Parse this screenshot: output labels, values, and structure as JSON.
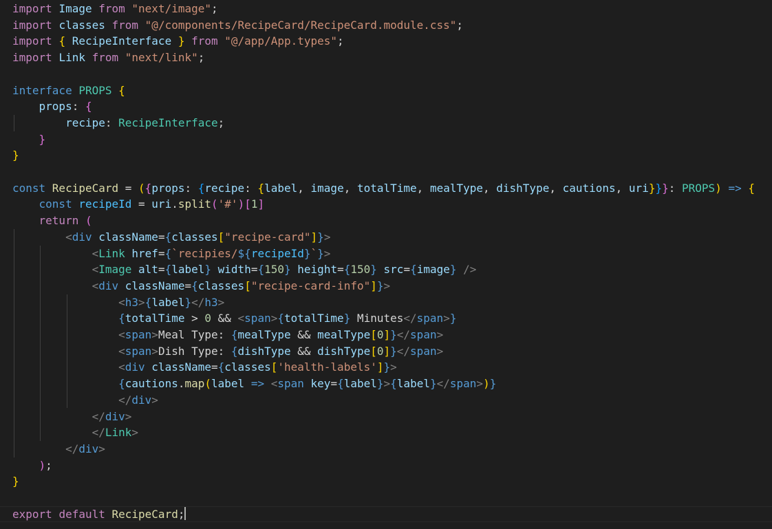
{
  "editor": {
    "colors": {
      "background": "#1e1e1e",
      "keyword": "#569cd6",
      "control": "#c586c0",
      "variable": "#9cdcfe",
      "function": "#dcdcaa",
      "type": "#4ec9b0",
      "string": "#ce9178",
      "number": "#b5cea8",
      "bracket_gold": "#ffd700",
      "bracket_orchid": "#da70d6",
      "bracket_blue": "#179fff"
    },
    "cursor_line": 31,
    "lines": [
      [
        [
          "import ",
          "ctl"
        ],
        [
          "Image ",
          "var"
        ],
        [
          "from ",
          "ctl"
        ],
        [
          "\"next/image\"",
          "str"
        ],
        [
          ";",
          "plain"
        ]
      ],
      [
        [
          "import ",
          "ctl"
        ],
        [
          "classes ",
          "var"
        ],
        [
          "from ",
          "ctl"
        ],
        [
          "\"@/components/RecipeCard/RecipeCard.module.css\"",
          "str"
        ],
        [
          ";",
          "plain"
        ]
      ],
      [
        [
          "import ",
          "ctl"
        ],
        [
          "{ ",
          "b1"
        ],
        [
          "RecipeInterface ",
          "var"
        ],
        [
          "} ",
          "b1"
        ],
        [
          "from ",
          "ctl"
        ],
        [
          "\"@/app/App.types\"",
          "str"
        ],
        [
          ";",
          "plain"
        ]
      ],
      [
        [
          "import ",
          "ctl"
        ],
        [
          "Link ",
          "var"
        ],
        [
          "from ",
          "ctl"
        ],
        [
          "\"next/link\"",
          "str"
        ],
        [
          ";",
          "plain"
        ]
      ],
      [],
      [
        [
          "interface ",
          "kw"
        ],
        [
          "PROPS ",
          "type"
        ],
        [
          "{",
          "b1"
        ]
      ],
      [
        [
          "    ",
          "plain"
        ],
        [
          "props",
          "var"
        ],
        [
          ": ",
          "plain"
        ],
        [
          "{",
          "b2"
        ]
      ],
      [
        [
          "        ",
          "plain"
        ],
        [
          "recipe",
          "var"
        ],
        [
          ": ",
          "plain"
        ],
        [
          "RecipeInterface",
          "type"
        ],
        [
          ";",
          "plain"
        ]
      ],
      [
        [
          "    ",
          "plain"
        ],
        [
          "}",
          "b2"
        ]
      ],
      [
        [
          "}",
          "b1"
        ]
      ],
      [],
      [
        [
          "const ",
          "kw"
        ],
        [
          "RecipeCard ",
          "fn"
        ],
        [
          "= ",
          "plain"
        ],
        [
          "(",
          "b1"
        ],
        [
          "{",
          "b2"
        ],
        [
          "props",
          "var"
        ],
        [
          ": ",
          "plain"
        ],
        [
          "{",
          "b3"
        ],
        [
          "recipe",
          "var"
        ],
        [
          ": ",
          "plain"
        ],
        [
          "{",
          "b1"
        ],
        [
          "label",
          "var"
        ],
        [
          ", ",
          "plain"
        ],
        [
          "image",
          "var"
        ],
        [
          ", ",
          "plain"
        ],
        [
          "totalTime",
          "var"
        ],
        [
          ", ",
          "plain"
        ],
        [
          "mealType",
          "var"
        ],
        [
          ", ",
          "plain"
        ],
        [
          "dishType",
          "var"
        ],
        [
          ", ",
          "plain"
        ],
        [
          "cautions",
          "var"
        ],
        [
          ", ",
          "plain"
        ],
        [
          "uri",
          "var"
        ],
        [
          "}",
          "b1"
        ],
        [
          "}",
          "b3"
        ],
        [
          "}",
          "b2"
        ],
        [
          ": ",
          "plain"
        ],
        [
          "PROPS",
          "type"
        ],
        [
          ") ",
          "b1"
        ],
        [
          "=> ",
          "kw"
        ],
        [
          "{",
          "b1"
        ]
      ],
      [
        [
          "    ",
          "plain"
        ],
        [
          "const ",
          "kw"
        ],
        [
          "recipeId ",
          "const"
        ],
        [
          "= ",
          "plain"
        ],
        [
          "uri",
          "var"
        ],
        [
          ".",
          "plain"
        ],
        [
          "split",
          "fn"
        ],
        [
          "(",
          "b2"
        ],
        [
          "'#'",
          "str"
        ],
        [
          ")",
          "b2"
        ],
        [
          "[",
          "b2"
        ],
        [
          "1",
          "num"
        ],
        [
          "]",
          "b2"
        ]
      ],
      [
        [
          "    ",
          "plain"
        ],
        [
          "return ",
          "ctl"
        ],
        [
          "(",
          "b2"
        ]
      ],
      [
        [
          "        ",
          "plain"
        ],
        [
          "<",
          "tag"
        ],
        [
          "div ",
          "kw"
        ],
        [
          "className",
          "var"
        ],
        [
          "=",
          "plain"
        ],
        [
          "{",
          "kw"
        ],
        [
          "classes",
          "var"
        ],
        [
          "[",
          "b1"
        ],
        [
          "\"recipe-card\"",
          "str"
        ],
        [
          "]",
          "b1"
        ],
        [
          "}",
          "kw"
        ],
        [
          ">",
          "tag"
        ]
      ],
      [
        [
          "            ",
          "plain"
        ],
        [
          "<",
          "tag"
        ],
        [
          "Link ",
          "type"
        ],
        [
          "href",
          "var"
        ],
        [
          "=",
          "plain"
        ],
        [
          "{",
          "kw"
        ],
        [
          "`recipies/",
          "str"
        ],
        [
          "${",
          "kw"
        ],
        [
          "recipeId",
          "const"
        ],
        [
          "}",
          "kw"
        ],
        [
          "`",
          "str"
        ],
        [
          "}",
          "kw"
        ],
        [
          ">",
          "tag"
        ]
      ],
      [
        [
          "            ",
          "plain"
        ],
        [
          "<",
          "tag"
        ],
        [
          "Image ",
          "type"
        ],
        [
          "alt",
          "var"
        ],
        [
          "=",
          "plain"
        ],
        [
          "{",
          "kw"
        ],
        [
          "label",
          "var"
        ],
        [
          "} ",
          "kw"
        ],
        [
          "width",
          "var"
        ],
        [
          "=",
          "plain"
        ],
        [
          "{",
          "kw"
        ],
        [
          "150",
          "num"
        ],
        [
          "} ",
          "kw"
        ],
        [
          "height",
          "var"
        ],
        [
          "=",
          "plain"
        ],
        [
          "{",
          "kw"
        ],
        [
          "150",
          "num"
        ],
        [
          "} ",
          "kw"
        ],
        [
          "src",
          "var"
        ],
        [
          "=",
          "plain"
        ],
        [
          "{",
          "kw"
        ],
        [
          "image",
          "var"
        ],
        [
          "} ",
          "kw"
        ],
        [
          "/>",
          "tag"
        ]
      ],
      [
        [
          "            ",
          "plain"
        ],
        [
          "<",
          "tag"
        ],
        [
          "div ",
          "kw"
        ],
        [
          "className",
          "var"
        ],
        [
          "=",
          "plain"
        ],
        [
          "{",
          "kw"
        ],
        [
          "classes",
          "var"
        ],
        [
          "[",
          "b1"
        ],
        [
          "\"recipe-card-info\"",
          "str"
        ],
        [
          "]",
          "b1"
        ],
        [
          "}",
          "kw"
        ],
        [
          ">",
          "tag"
        ]
      ],
      [
        [
          "                ",
          "plain"
        ],
        [
          "<",
          "tag"
        ],
        [
          "h3",
          "kw"
        ],
        [
          ">",
          "tag"
        ],
        [
          "{",
          "kw"
        ],
        [
          "label",
          "var"
        ],
        [
          "}",
          "kw"
        ],
        [
          "</",
          "tag"
        ],
        [
          "h3",
          "kw"
        ],
        [
          ">",
          "tag"
        ]
      ],
      [
        [
          "                ",
          "plain"
        ],
        [
          "{",
          "kw"
        ],
        [
          "totalTime ",
          "var"
        ],
        [
          "> ",
          "plain"
        ],
        [
          "0 ",
          "num"
        ],
        [
          "&& ",
          "plain"
        ],
        [
          "<",
          "tag"
        ],
        [
          "span",
          "kw"
        ],
        [
          ">",
          "tag"
        ],
        [
          "{",
          "kw"
        ],
        [
          "totalTime",
          "var"
        ],
        [
          "} ",
          "kw"
        ],
        [
          "Minutes",
          "plain"
        ],
        [
          "</",
          "tag"
        ],
        [
          "span",
          "kw"
        ],
        [
          ">",
          "tag"
        ],
        [
          "}",
          "kw"
        ]
      ],
      [
        [
          "                ",
          "plain"
        ],
        [
          "<",
          "tag"
        ],
        [
          "span",
          "kw"
        ],
        [
          ">",
          "tag"
        ],
        [
          "Meal Type: ",
          "plain"
        ],
        [
          "{",
          "kw"
        ],
        [
          "mealType ",
          "var"
        ],
        [
          "&& ",
          "plain"
        ],
        [
          "mealType",
          "var"
        ],
        [
          "[",
          "b1"
        ],
        [
          "0",
          "num"
        ],
        [
          "]",
          "b1"
        ],
        [
          "}",
          "kw"
        ],
        [
          "</",
          "tag"
        ],
        [
          "span",
          "kw"
        ],
        [
          ">",
          "tag"
        ]
      ],
      [
        [
          "                ",
          "plain"
        ],
        [
          "<",
          "tag"
        ],
        [
          "span",
          "kw"
        ],
        [
          ">",
          "tag"
        ],
        [
          "Dish Type: ",
          "plain"
        ],
        [
          "{",
          "kw"
        ],
        [
          "dishType ",
          "var"
        ],
        [
          "&& ",
          "plain"
        ],
        [
          "dishType",
          "var"
        ],
        [
          "[",
          "b1"
        ],
        [
          "0",
          "num"
        ],
        [
          "]",
          "b1"
        ],
        [
          "}",
          "kw"
        ],
        [
          "</",
          "tag"
        ],
        [
          "span",
          "kw"
        ],
        [
          ">",
          "tag"
        ]
      ],
      [
        [
          "                ",
          "plain"
        ],
        [
          "<",
          "tag"
        ],
        [
          "div ",
          "kw"
        ],
        [
          "className",
          "var"
        ],
        [
          "=",
          "plain"
        ],
        [
          "{",
          "kw"
        ],
        [
          "classes",
          "var"
        ],
        [
          "[",
          "b1"
        ],
        [
          "'health-labels'",
          "str"
        ],
        [
          "]",
          "b1"
        ],
        [
          "}",
          "kw"
        ],
        [
          ">",
          "tag"
        ]
      ],
      [
        [
          "                ",
          "plain"
        ],
        [
          "{",
          "kw"
        ],
        [
          "cautions",
          "var"
        ],
        [
          ".",
          "plain"
        ],
        [
          "map",
          "fn"
        ],
        [
          "(",
          "b1"
        ],
        [
          "label ",
          "var"
        ],
        [
          "=> ",
          "kw"
        ],
        [
          "<",
          "tag"
        ],
        [
          "span ",
          "kw"
        ],
        [
          "key",
          "var"
        ],
        [
          "=",
          "plain"
        ],
        [
          "{",
          "kw"
        ],
        [
          "label",
          "var"
        ],
        [
          "}",
          "kw"
        ],
        [
          ">",
          "tag"
        ],
        [
          "{",
          "kw"
        ],
        [
          "label",
          "var"
        ],
        [
          "}",
          "kw"
        ],
        [
          "</",
          "tag"
        ],
        [
          "span",
          "kw"
        ],
        [
          ">",
          "tag"
        ],
        [
          ")",
          "b1"
        ],
        [
          "}",
          "kw"
        ]
      ],
      [
        [
          "                ",
          "plain"
        ],
        [
          "</",
          "tag"
        ],
        [
          "div",
          "kw"
        ],
        [
          ">",
          "tag"
        ]
      ],
      [
        [
          "            ",
          "plain"
        ],
        [
          "</",
          "tag"
        ],
        [
          "div",
          "kw"
        ],
        [
          ">",
          "tag"
        ]
      ],
      [
        [
          "            ",
          "plain"
        ],
        [
          "</",
          "tag"
        ],
        [
          "Link",
          "type"
        ],
        [
          ">",
          "tag"
        ]
      ],
      [
        [
          "        ",
          "plain"
        ],
        [
          "</",
          "tag"
        ],
        [
          "div",
          "kw"
        ],
        [
          ">",
          "tag"
        ]
      ],
      [
        [
          "    ",
          "plain"
        ],
        [
          ")",
          "b2"
        ],
        [
          ";",
          "plain"
        ]
      ],
      [
        [
          "}",
          "b1"
        ]
      ],
      [],
      [
        [
          "export ",
          "ctl"
        ],
        [
          "default ",
          "ctl"
        ],
        [
          "RecipeCard",
          "fn"
        ],
        [
          ";",
          "plain"
        ]
      ]
    ]
  }
}
